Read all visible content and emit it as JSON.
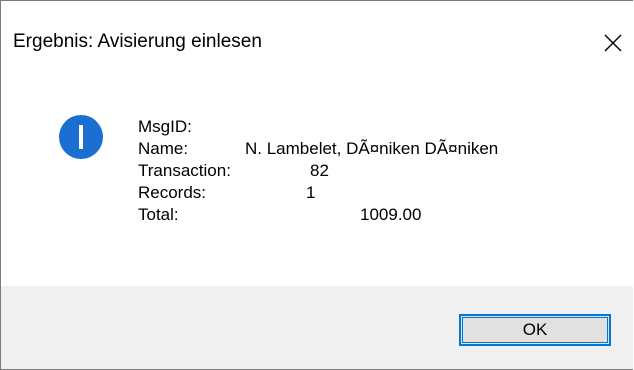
{
  "window": {
    "title": "Ergebnis: Avisierung einlesen",
    "close_glyph": "✕"
  },
  "icon": {
    "name": "information-icon",
    "glyph": "i",
    "color": "#1a6fd0"
  },
  "message": {
    "msgid_label": "MsgID:",
    "msgid_value": "",
    "name_label": "Name:",
    "name_value": "N. Lambelet, DÃ¤niken DÃ¤niken",
    "transaction_label": "Transaction:",
    "transaction_value": "82",
    "records_label": "Records:",
    "records_value": "1",
    "total_label": "Total:",
    "total_value": "1009.00"
  },
  "buttons": {
    "ok_label": "OK"
  },
  "colors": {
    "accent": "#0078d7",
    "footer_bg": "#f0f0f0",
    "button_bg": "#e1e1e1"
  }
}
